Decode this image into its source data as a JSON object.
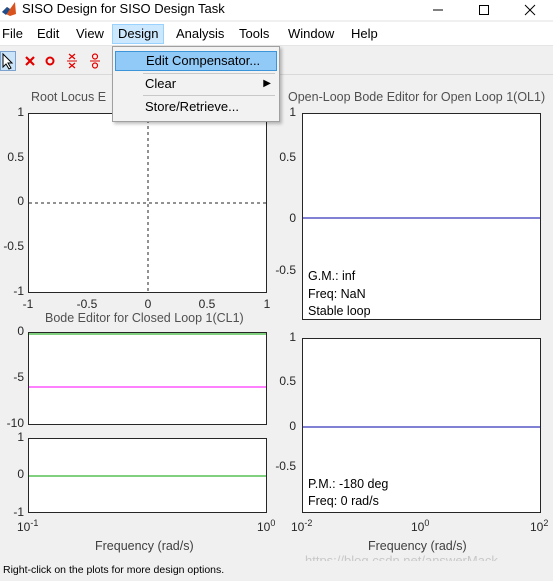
{
  "window": {
    "title": "SISO Design for SISO Design Task",
    "minimize_icon": "minimize-icon",
    "maximize_icon": "maximize-icon",
    "close_icon": "close-icon"
  },
  "menubar": {
    "items": [
      "File",
      "Edit",
      "View",
      "Design",
      "Analysis",
      "Tools",
      "Window",
      "Help"
    ],
    "active": "Design"
  },
  "design_menu": {
    "items": [
      {
        "label": "Edit Compensator...",
        "highlighted": true
      },
      {
        "label": "Clear",
        "submenu": true
      },
      {
        "label": "Store/Retrieve..."
      }
    ]
  },
  "toolbar": {
    "tools": [
      "select-arrow-icon",
      "delete-red-x-icon",
      "zero-circle-icon",
      "pole-x-icon",
      "complex-zero-icon"
    ]
  },
  "plots": {
    "root_locus": {
      "title": "Root Locus Editor for Open Loop 1(OL1)",
      "visible_title": "Root Locus E",
      "yticks": [
        "1",
        "0.5",
        "0",
        "-0.5",
        "-1"
      ],
      "xticks": [
        "-1",
        "-0.5",
        "0",
        "0.5",
        "1"
      ]
    },
    "closed_loop": {
      "title": "Bode Editor for Closed Loop 1(CL1)",
      "mag_yticks": [
        "0",
        "-5",
        "-10"
      ],
      "phase_yticks": [
        "1",
        "0",
        "-1"
      ],
      "xtick_base": [
        "10",
        "10"
      ],
      "xtick_exp": [
        "-1",
        "0"
      ],
      "xlabel": "Frequency (rad/s)",
      "mag_line_color": "#ff00ff",
      "phase_line_color": "#00a000"
    },
    "open_loop": {
      "title": "Open-Loop Bode Editor for Open Loop 1(OL1)",
      "mag_yticks": [
        "1",
        "0.5",
        "0",
        "-0.5"
      ],
      "phase_yticks": [
        "1",
        "0.5",
        "0",
        "-0.5"
      ],
      "xtick_base": [
        "10",
        "10",
        "10"
      ],
      "xtick_exp": [
        "-2",
        "0",
        "2"
      ],
      "xlabel": "Frequency (rad/s)",
      "line_color": "#0000aa",
      "mag_annotations": [
        "G.M.: inf",
        "Freq: NaN",
        "Stable loop"
      ],
      "phase_annotations": [
        "P.M.: -180 deg",
        "Freq: 0 rad/s"
      ]
    }
  },
  "status": {
    "text": "Right-click on the plots for more design options."
  },
  "watermark": "https://blog.csdn.net/answerMack"
}
